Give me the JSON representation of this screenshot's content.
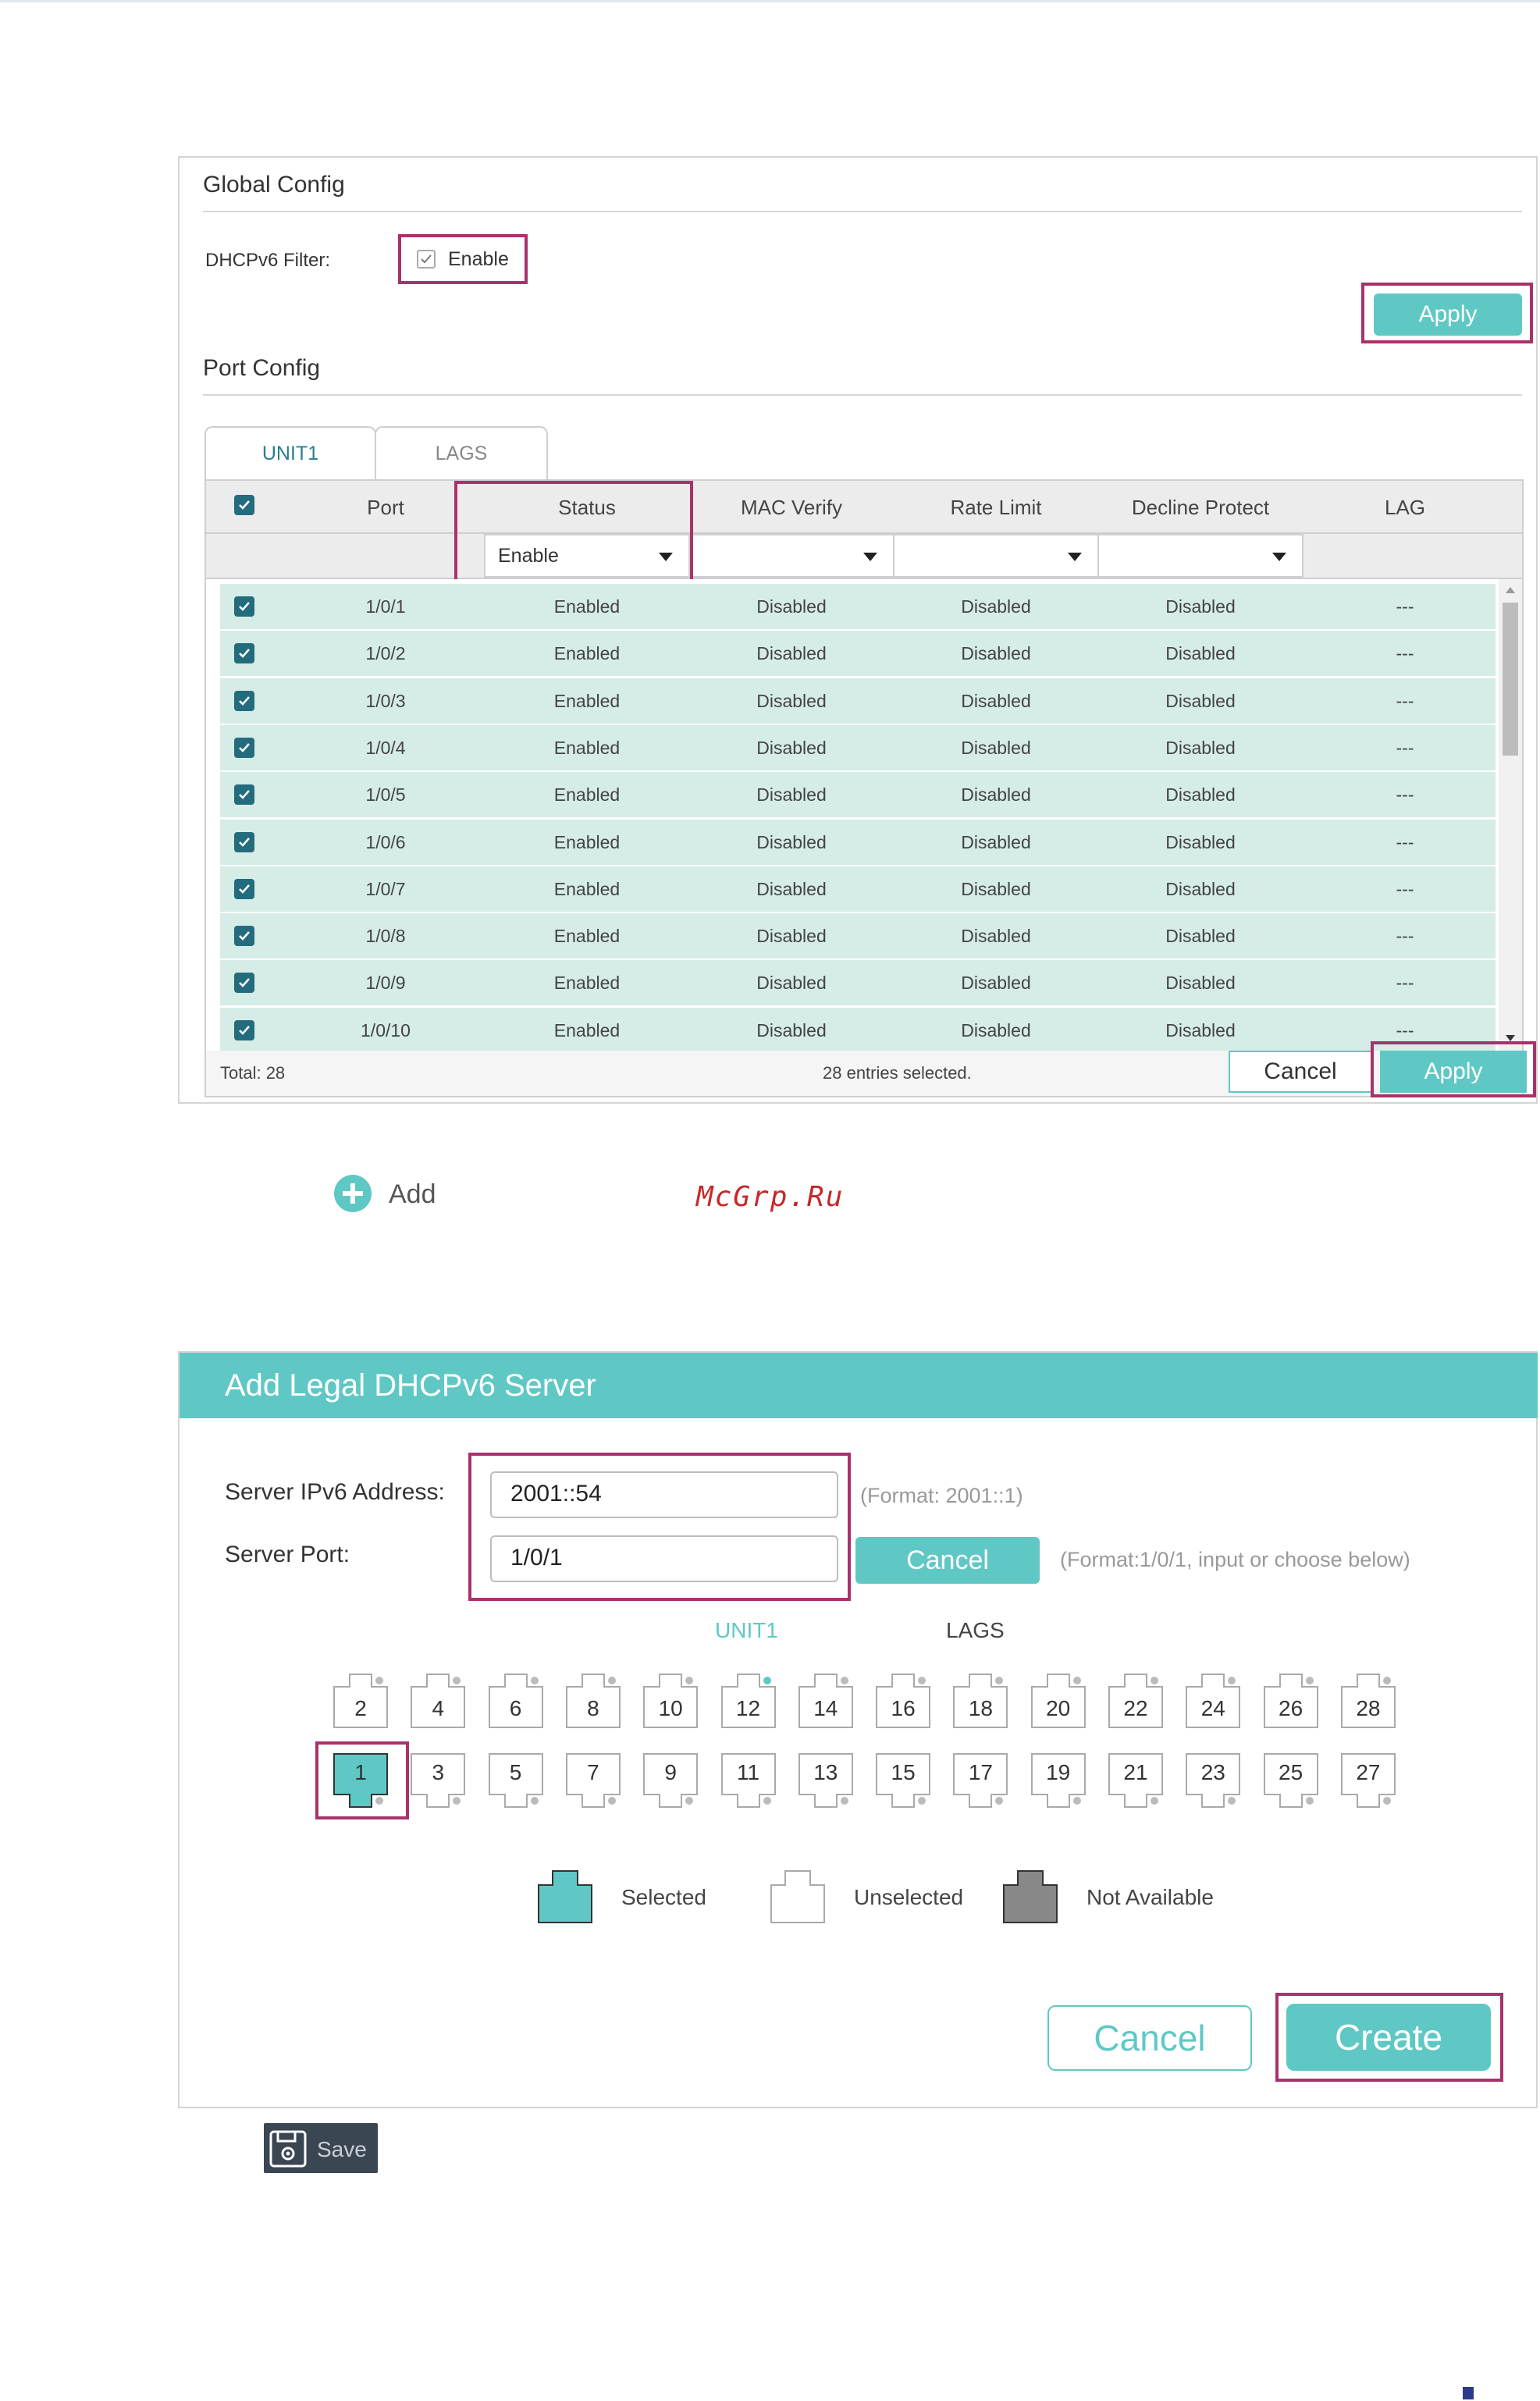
{
  "global_config": {
    "title": "Global Config",
    "filter_label": "DHCPv6 Filter:",
    "enable_label": "Enable",
    "apply_label": "Apply"
  },
  "port_config": {
    "title": "Port Config",
    "tabs": [
      "UNIT1",
      "LAGS"
    ],
    "columns": [
      "Port",
      "Status",
      "MAC Verify",
      "Rate Limit",
      "Decline Protect",
      "LAG"
    ],
    "filter_status_value": "Enable",
    "rows": [
      {
        "port": "1/0/1",
        "status": "Enabled",
        "mac": "Disabled",
        "rate": "Disabled",
        "decline": "Disabled",
        "lag": "---"
      },
      {
        "port": "1/0/2",
        "status": "Enabled",
        "mac": "Disabled",
        "rate": "Disabled",
        "decline": "Disabled",
        "lag": "---"
      },
      {
        "port": "1/0/3",
        "status": "Enabled",
        "mac": "Disabled",
        "rate": "Disabled",
        "decline": "Disabled",
        "lag": "---"
      },
      {
        "port": "1/0/4",
        "status": "Enabled",
        "mac": "Disabled",
        "rate": "Disabled",
        "decline": "Disabled",
        "lag": "---"
      },
      {
        "port": "1/0/5",
        "status": "Enabled",
        "mac": "Disabled",
        "rate": "Disabled",
        "decline": "Disabled",
        "lag": "---"
      },
      {
        "port": "1/0/6",
        "status": "Enabled",
        "mac": "Disabled",
        "rate": "Disabled",
        "decline": "Disabled",
        "lag": "---"
      },
      {
        "port": "1/0/7",
        "status": "Enabled",
        "mac": "Disabled",
        "rate": "Disabled",
        "decline": "Disabled",
        "lag": "---"
      },
      {
        "port": "1/0/8",
        "status": "Enabled",
        "mac": "Disabled",
        "rate": "Disabled",
        "decline": "Disabled",
        "lag": "---"
      },
      {
        "port": "1/0/9",
        "status": "Enabled",
        "mac": "Disabled",
        "rate": "Disabled",
        "decline": "Disabled",
        "lag": "---"
      },
      {
        "port": "1/0/10",
        "status": "Enabled",
        "mac": "Disabled",
        "rate": "Disabled",
        "decline": "Disabled",
        "lag": "---"
      }
    ],
    "total": "Total: 28",
    "selected_text": "28 entries selected.",
    "cancel_label": "Cancel",
    "apply_label": "Apply"
  },
  "add": {
    "label": "Add"
  },
  "watermark": "McGrp.Ru",
  "modal": {
    "title": "Add Legal DHCPv6 Server",
    "ip_label": "Server IPv6 Address:",
    "ip_value": "2001::54",
    "ip_hint": "(Format: 2001::1)",
    "port_label": "Server Port:",
    "port_value": "1/0/1",
    "port_cancel": "Cancel",
    "port_hint": "(Format:1/0/1, input or choose below)",
    "unit_tabs": [
      "UNIT1",
      "LAGS"
    ],
    "even_ports": [
      "2",
      "4",
      "6",
      "8",
      "10",
      "12",
      "14",
      "16",
      "18",
      "20",
      "22",
      "24",
      "26",
      "28"
    ],
    "odd_ports": [
      "1",
      "3",
      "5",
      "7",
      "9",
      "11",
      "13",
      "15",
      "17",
      "19",
      "21",
      "23",
      "25",
      "27"
    ],
    "selected_port": "1",
    "legend": [
      "Selected",
      "Unselected",
      "Not Available"
    ],
    "cancel_label": "Cancel",
    "create_label": "Create"
  },
  "save": {
    "label": "Save"
  },
  "colors": {
    "accent": "#5fc8c5",
    "highlight": "#a8326c",
    "row_bg": "#d5ece7",
    "check": "#236c7d"
  }
}
